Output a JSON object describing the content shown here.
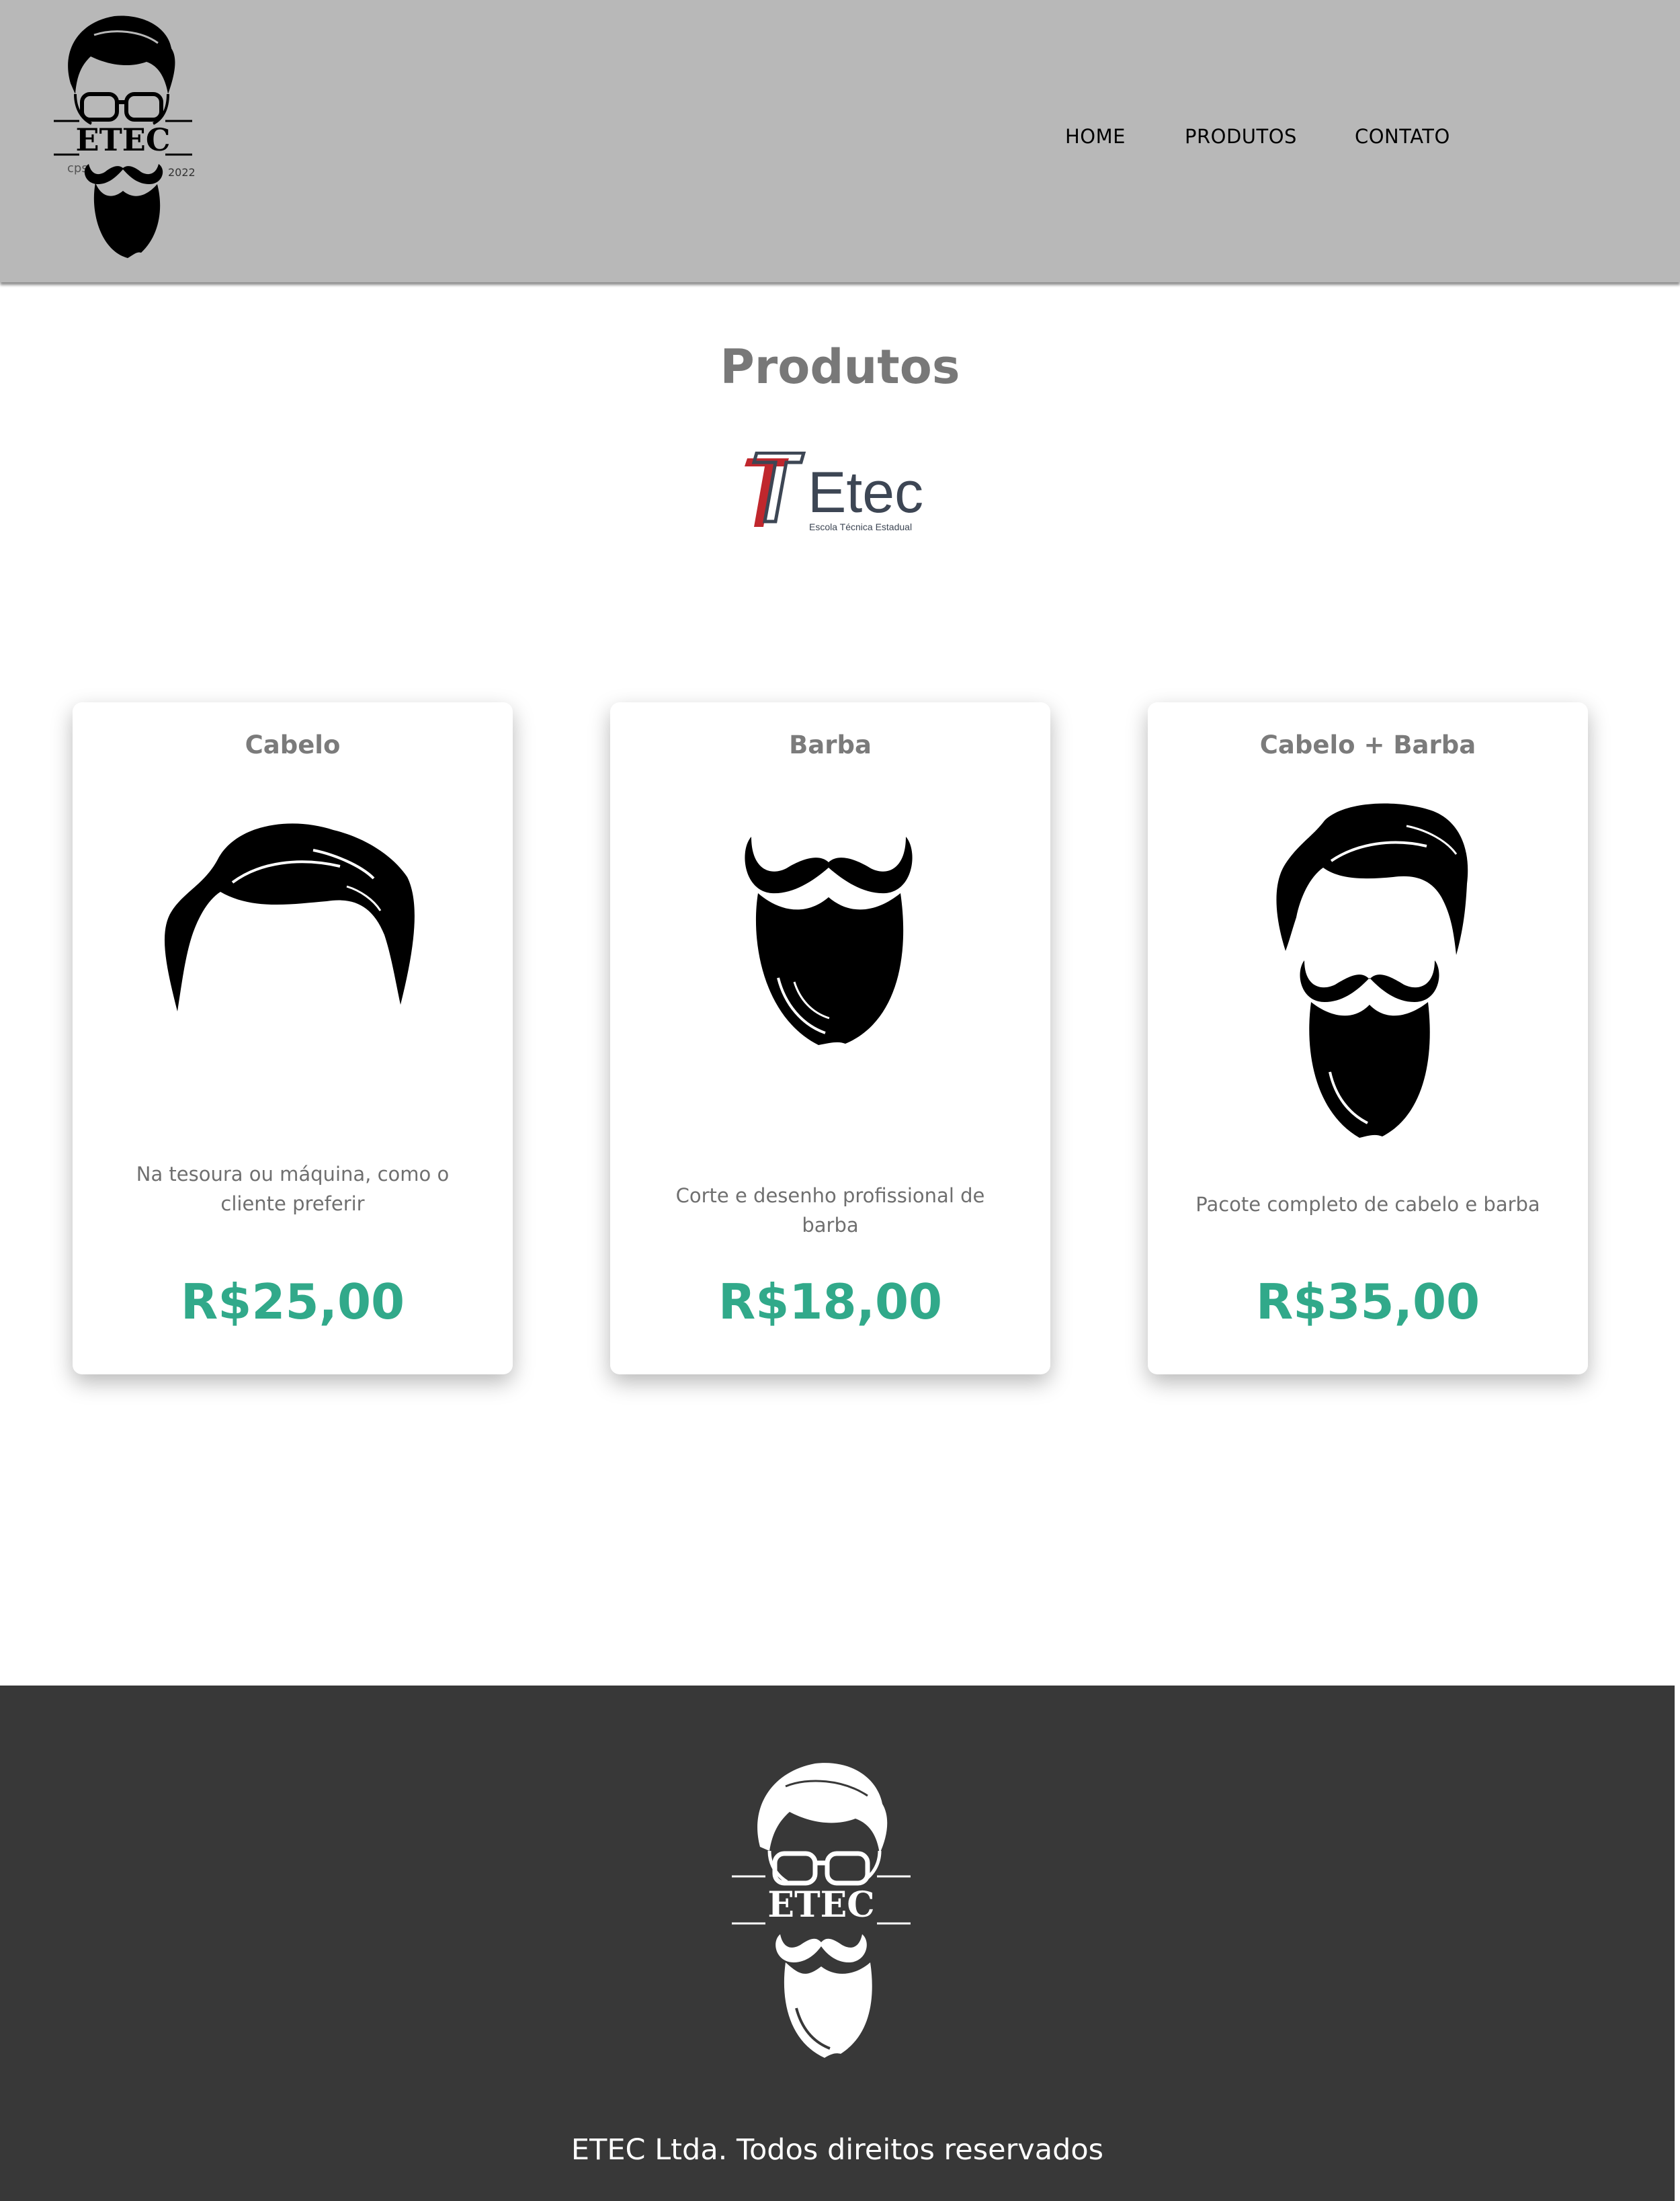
{
  "header": {
    "logo": {
      "icon": "bearded-man-logo",
      "brand": "ETEC",
      "left_caption": "cps",
      "right_caption": "2022"
    },
    "nav": [
      {
        "label": "HOME"
      },
      {
        "label": "PRODUTOS"
      },
      {
        "label": "CONTATO"
      }
    ]
  },
  "page": {
    "title": "Produtos",
    "partner_logo": {
      "name": "Etec",
      "subtitle": "Escola Técnica Estadual"
    }
  },
  "products": [
    {
      "title": "Cabelo",
      "icon": "hair-icon",
      "description": "Na tesoura ou máquina, como o cliente preferir",
      "price": "R$25,00"
    },
    {
      "title": "Barba",
      "icon": "beard-icon",
      "description": "Corte e desenho profissional de barba",
      "price": "R$18,00"
    },
    {
      "title": "Cabelo + Barba",
      "icon": "hair-and-beard-icon",
      "description": "Pacote completo de cabelo e barba",
      "price": "R$35,00"
    }
  ],
  "footer": {
    "logo": {
      "icon": "bearded-man-logo",
      "brand": "ETEC"
    },
    "copyright": "ETEC Ltda. Todos direitos reservados"
  },
  "colors": {
    "header_bg": "#b8b8b8",
    "footer_bg": "#383838",
    "price": "#31a98a",
    "title": "#787878",
    "etec_red": "#c0272d",
    "etec_navy": "#3d4654"
  }
}
